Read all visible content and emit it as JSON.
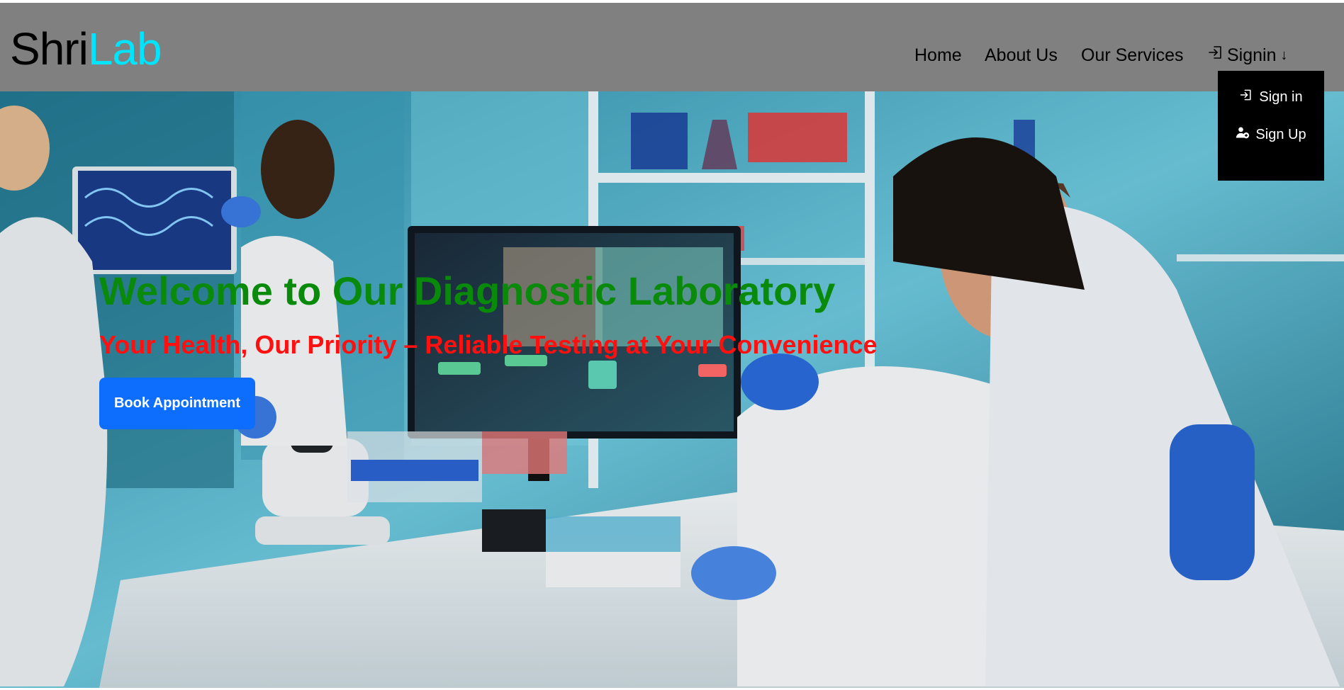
{
  "brand": {
    "part1": "Shri",
    "part2": "Lab"
  },
  "nav": {
    "home": "Home",
    "about": "About Us",
    "services": "Our Services",
    "signin": "Signin",
    "signin_arrow": "↓"
  },
  "dropdown": {
    "sign_in": "Sign in",
    "sign_up": "Sign Up"
  },
  "hero": {
    "title": "Welcome to Our Diagnostic Laboratory",
    "subtitle": "Your Health, Our Priority – Reliable Testing at Your Convenience",
    "cta": "Book Appointment"
  },
  "colors": {
    "navbar": "#808080",
    "brand_accent": "#00e5ff",
    "title": "#0a8a0a",
    "subtitle": "#ff1010",
    "cta": "#0d6efd",
    "dropdown": "#000000"
  },
  "icons": {
    "signin": "login-icon",
    "signup": "user-add-icon"
  }
}
